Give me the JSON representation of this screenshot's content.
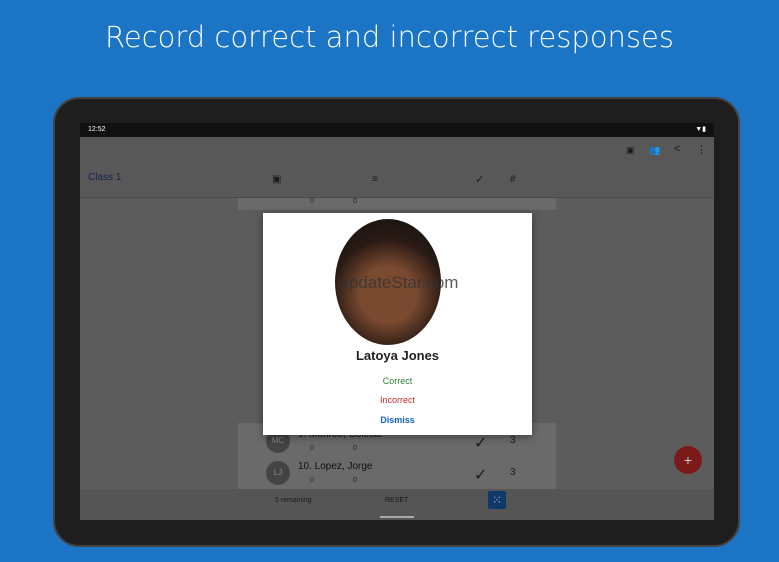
{
  "headline": "Record correct and incorrect responses",
  "status": {
    "time": "12:52"
  },
  "toolbar": {
    "icons": [
      "pdf-icon",
      "group-icon",
      "share-icon",
      "more-icon"
    ]
  },
  "class_name": "Class 1",
  "columns": {
    "check": "✓",
    "hash": "#"
  },
  "students": [
    {
      "initials": "MC",
      "name": "9. Monroe, Celeste",
      "correct": "0",
      "incorrect": "0",
      "count": "3"
    },
    {
      "initials": "LJ",
      "name": "10. Lopez, Jorge",
      "correct": "0",
      "incorrect": "0",
      "count": "3"
    }
  ],
  "top_row": {
    "correct": "0",
    "incorrect": "0"
  },
  "bottom": {
    "remaining": "5 remaining",
    "reset": "RESET"
  },
  "fab": "+",
  "dialog": {
    "name": "Latoya Jones",
    "correct": "Correct",
    "incorrect": "Incorrect",
    "dismiss": "Dismiss",
    "watermark": "UpdateStar.com"
  },
  "colors": {
    "background": "#1b74c4",
    "correct": "#2e7d32",
    "incorrect": "#c62828",
    "dismiss": "#1565c0",
    "fab": "#c62828"
  }
}
